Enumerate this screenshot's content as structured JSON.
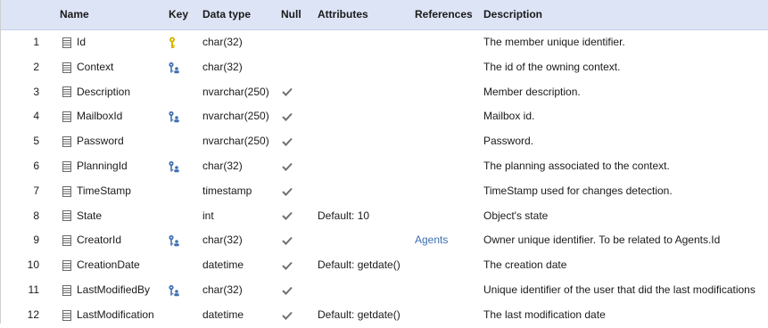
{
  "columns": {
    "name": "Name",
    "key": "Key",
    "data_type": "Data type",
    "null": "Null",
    "attributes": "Attributes",
    "references": "References",
    "description": "Description"
  },
  "rows": [
    {
      "num": "1",
      "name": "Id",
      "key": "primary-key-icon",
      "type": "char(32)",
      "nullable": false,
      "attributes": "",
      "references": "",
      "description": "The member unique identifier."
    },
    {
      "num": "2",
      "name": "Context",
      "key": "foreign-key-icon",
      "type": "char(32)",
      "nullable": false,
      "attributes": "",
      "references": "",
      "description": "The id of the owning context."
    },
    {
      "num": "3",
      "name": "Description",
      "key": "",
      "type": "nvarchar(250)",
      "nullable": true,
      "attributes": "",
      "references": "",
      "description": "Member description."
    },
    {
      "num": "4",
      "name": "MailboxId",
      "key": "foreign-key-icon",
      "type": "nvarchar(250)",
      "nullable": true,
      "attributes": "",
      "references": "",
      "description": "Mailbox id."
    },
    {
      "num": "5",
      "name": "Password",
      "key": "",
      "type": "nvarchar(250)",
      "nullable": true,
      "attributes": "",
      "references": "",
      "description": "Password."
    },
    {
      "num": "6",
      "name": "PlanningId",
      "key": "foreign-key-icon",
      "type": "char(32)",
      "nullable": true,
      "attributes": "",
      "references": "",
      "description": "The planning associated to the context."
    },
    {
      "num": "7",
      "name": "TimeStamp",
      "key": "",
      "type": "timestamp",
      "nullable": true,
      "attributes": "",
      "references": "",
      "description": "TimeStamp used for changes detection."
    },
    {
      "num": "8",
      "name": "State",
      "key": "",
      "type": "int",
      "nullable": true,
      "attributes": "Default: 10",
      "references": "",
      "description": "Object's state"
    },
    {
      "num": "9",
      "name": "CreatorId",
      "key": "foreign-key-icon",
      "type": "char(32)",
      "nullable": true,
      "attributes": "",
      "references": "Agents",
      "description": "Owner unique identifier. To be related to Agents.Id"
    },
    {
      "num": "10",
      "name": "CreationDate",
      "key": "",
      "type": "datetime",
      "nullable": true,
      "attributes": "Default: getdate()",
      "references": "",
      "description": "The creation date"
    },
    {
      "num": "11",
      "name": "LastModifiedBy",
      "key": "foreign-key-icon",
      "type": "char(32)",
      "nullable": true,
      "attributes": "",
      "references": "",
      "description": "Unique identifier of the user that did the last modifications"
    },
    {
      "num": "12",
      "name": "LastModification",
      "key": "",
      "type": "datetime",
      "nullable": true,
      "attributes": "Default: getdate()",
      "references": "",
      "description": "The last modification date"
    }
  ],
  "colors": {
    "header_bg": "#dde4f6",
    "link": "#3c6fb4",
    "primary_key": "#d4b400",
    "foreign_key": "#3f6fb0",
    "check": "#707070",
    "column_icon": "#6b6b6b"
  }
}
